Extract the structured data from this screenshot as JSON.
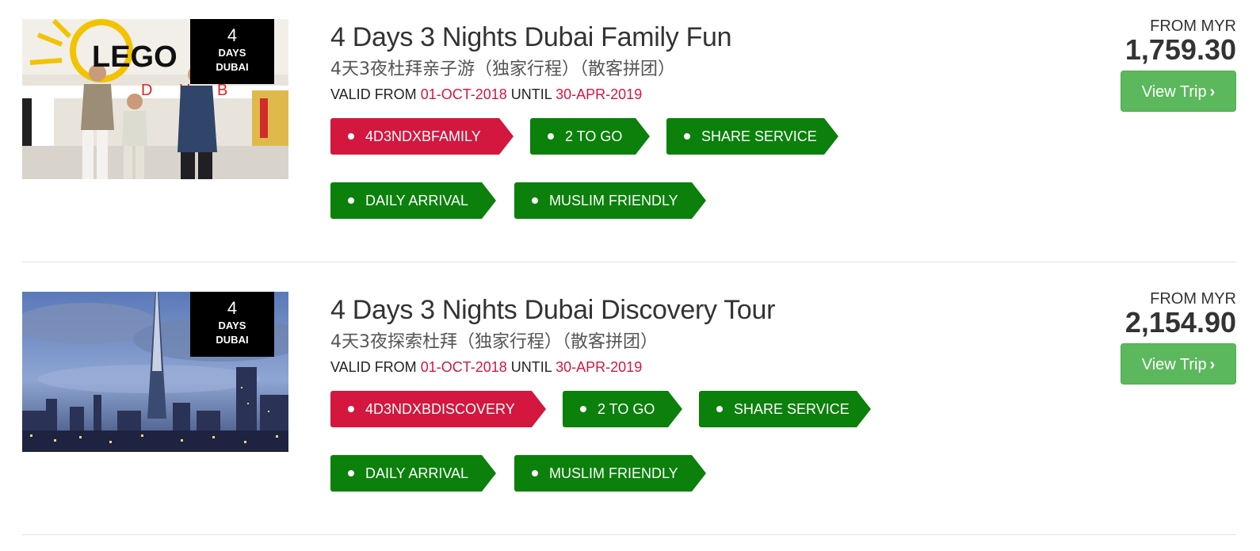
{
  "trips": [
    {
      "title": "4 Days 3 Nights Dubai Family Fun",
      "subtitle": "4天3夜杜拜亲子游（独家行程）（散客拼团）",
      "badge": {
        "number": "4",
        "unit": "DAYS",
        "city": "DUBAI"
      },
      "validity": {
        "from_label": "VALID FROM",
        "from_date": "01-OCT-2018",
        "until_label": "UNTIL",
        "until_date": "30-APR-2019"
      },
      "tags": [
        "4D3NDXBFAMILY",
        "2 TO GO",
        "SHARE SERVICE",
        "DAILY ARRIVAL",
        "MUSLIM FRIENDLY"
      ],
      "from_label": "FROM MYR",
      "price": "1,759.30",
      "button_label": "View Trip",
      "image_text": "LEGO"
    },
    {
      "title": "4 Days 3 Nights Dubai Discovery Tour",
      "subtitle": "4天3夜探索杜拜（独家行程）（散客拼团）",
      "badge": {
        "number": "4",
        "unit": "DAYS",
        "city": "DUBAI"
      },
      "validity": {
        "from_label": "VALID FROM",
        "from_date": "01-OCT-2018",
        "until_label": "UNTIL",
        "until_date": "30-APR-2019"
      },
      "tags": [
        "4D3NDXBDISCOVERY",
        "2 TO GO",
        "SHARE SERVICE",
        "DAILY ARRIVAL",
        "MUSLIM FRIENDLY"
      ],
      "from_label": "FROM MYR",
      "price": "2,154.90",
      "button_label": "View Trip"
    }
  ],
  "colors": {
    "code_tag": "#d3173e",
    "feature_tag": "#0b800b",
    "button": "#5cb85c",
    "date": "#d3173e"
  },
  "icons": {
    "button_chevron": "chevron-right-icon",
    "tag_bullet": "bullet-dot-icon"
  }
}
